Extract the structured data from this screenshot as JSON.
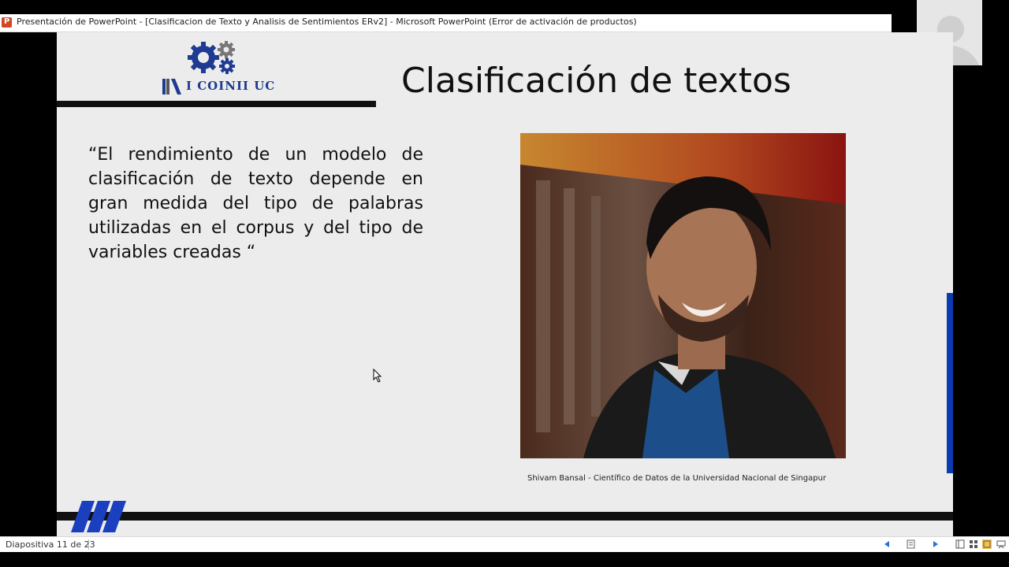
{
  "window": {
    "title": "Presentación de PowerPoint - [Clasificacion de Texto y Analisis de Sentimientos ERv2] - Microsoft PowerPoint (Error de activación de productos)",
    "app_icon_letter": "P"
  },
  "slide": {
    "logo_text": "I COINII UC",
    "title": "Clasificación de textos",
    "quote": "“El rendimiento de un modelo de clasificación de texto depende en gran medida del tipo de palabras utilizadas en el corpus y del tipo de variables creadas “",
    "caption": "Shivam Bansal  - Científico de Datos de la Universidad Nacional de Singapur"
  },
  "status": {
    "slide_counter": "Diapositiva 11 de 23"
  },
  "colors": {
    "brand_blue": "#1f3a93",
    "accent_bar": "#0a3bb0",
    "powerpoint_orange": "#d24726"
  },
  "icons": [
    "presentation-app-icon",
    "gears-icon",
    "book-icon",
    "participant-avatar-icon",
    "prev-slide-icon",
    "notes-icon",
    "next-slide-icon",
    "normal-view-icon",
    "slide-sorter-icon",
    "reading-view-icon",
    "slideshow-icon"
  ]
}
